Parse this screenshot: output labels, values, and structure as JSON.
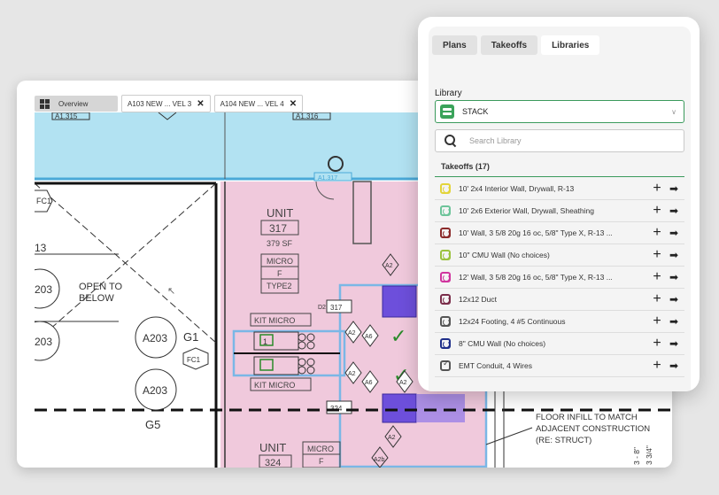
{
  "tabs": [
    {
      "label": "Overview"
    },
    {
      "label": "A103 NEW ... VEL 3"
    },
    {
      "label": "A104 NEW ... VEL 4"
    }
  ],
  "drawing": {
    "tag_a1315": "A1.315",
    "tag_a1316": "A1.316",
    "fc1_top": "FC1",
    "fc1_mid": "FC1",
    "grid_13": "13",
    "grid_203_top": "203",
    "grid_203_bottom": "203",
    "open_to": "OPEN TO",
    "below": "BELOW",
    "a203_top": "A203",
    "a203_bottom": "A203",
    "g1": "G1",
    "g5": "G5",
    "unit": "UNIT",
    "unit_no": "317",
    "unit_area": "379 SF",
    "micro": "MICRO",
    "micro_f": "F",
    "micro_type": "TYPE2",
    "kit_micro_top": "KIT MICRO",
    "kit_micro_bottom": "KIT MICRO",
    "a2_1": "A2",
    "a2_2": "A2",
    "a2_3": "A2",
    "a2_4": "A2",
    "a2_5": "A2",
    "a2_6": "A2",
    "a6_1": "A6",
    "a6_2": "A6",
    "d2_317": "317",
    "d2_324": "324",
    "d2": "D2",
    "fixture_1": "1",
    "unit2": "UNIT",
    "unit2_no": "324",
    "micro2": "MICRO",
    "micro2_f": "F",
    "a2b": "A2b",
    "note_line1": "FLOOR INFILL TO MATCH",
    "note_line2": "ADJACENT CONSTRUCTION",
    "note_line3": "(RE: STRUCT)",
    "dim_1": "3 - 8\"",
    "dim_2": "3 3/4\"",
    "ws_label": "A1.317"
  },
  "panel": {
    "tabs": [
      {
        "label": "Plans",
        "active": false
      },
      {
        "label": "Takeoffs",
        "active": false
      },
      {
        "label": "Libraries",
        "active": true
      }
    ],
    "library_label": "Library",
    "library_selected": "STACK",
    "search_placeholder": "Search Library",
    "takeoffs_header": "Takeoffs (17)",
    "takeoffs": [
      {
        "name": "10' 2x4 Interior Wall, Drywall, R-13",
        "color": "#e3d43a",
        "kind": "area"
      },
      {
        "name": "10' 2x6 Exterior Wall, Drywall, Sheathing",
        "color": "#6dc49a",
        "kind": "area"
      },
      {
        "name": "10' Wall, 3 5/8 20g 16 oc, 5/8\" Type X, R-13 ...",
        "color": "#8b2a2a",
        "kind": "area"
      },
      {
        "name": "10\" CMU Wall (No choices)",
        "color": "#9bc23e",
        "kind": "area"
      },
      {
        "name": "12' Wall, 3 5/8 20g 16 oc, 5/8\" Type X, R-13 ...",
        "color": "#d0349e",
        "kind": "area"
      },
      {
        "name": "12x12 Duct",
        "color": "#7a2d4a",
        "kind": "area"
      },
      {
        "name": "12x24 Footing, 4 #5 Continuous",
        "color": "#555555",
        "kind": "area"
      },
      {
        "name": "8\" CMU Wall (No choices)",
        "color": "#1f2f8a",
        "kind": "area"
      },
      {
        "name": "EMT Conduit, 4 Wires",
        "color": "#555555",
        "kind": "count"
      }
    ],
    "icons": {
      "add": "plus-icon",
      "apply": "arrow-right-icon"
    },
    "add_glyph": "+",
    "apply_glyph": "➡"
  },
  "colors": {
    "walkway_blue": "#b2e2f2",
    "unit_pink": "#f0c9dc",
    "highlight_purple": "#6d4fdb",
    "accent_green": "#3a9a5c"
  }
}
